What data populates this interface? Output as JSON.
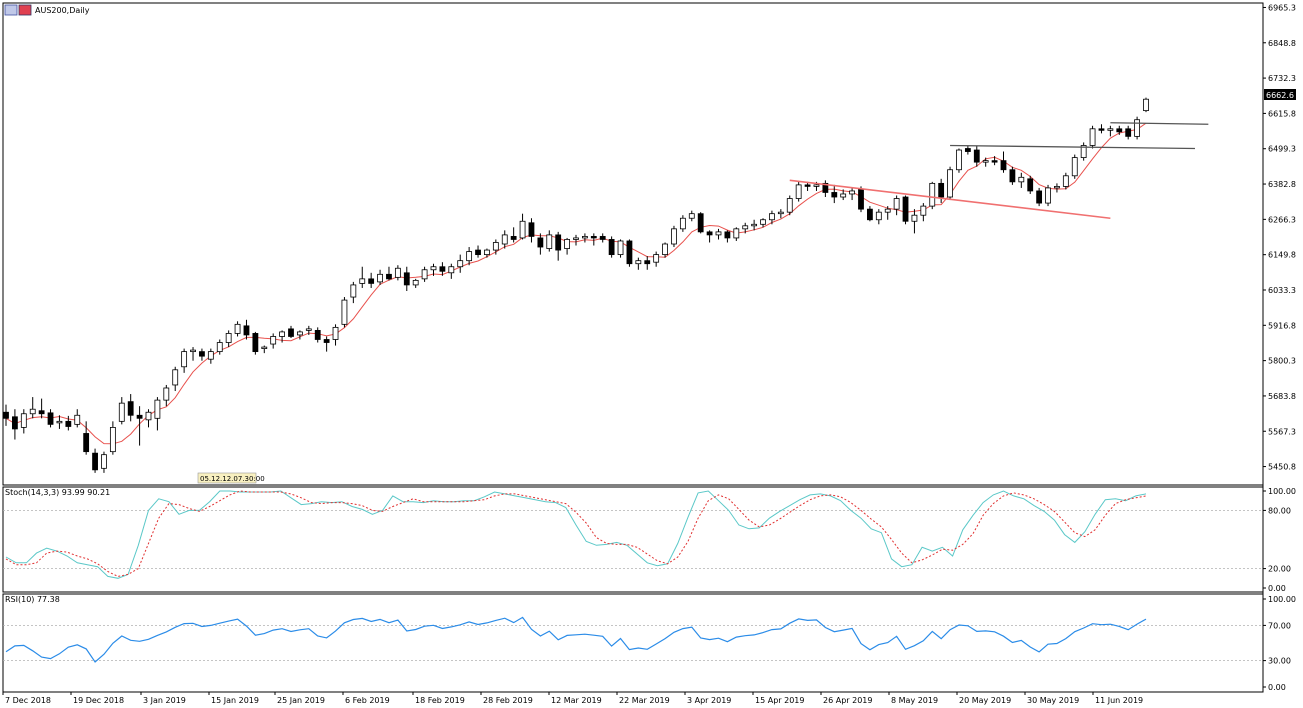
{
  "window": {
    "title": "AUS200,Daily"
  },
  "toolbar_badge": "05.12.12.07.30:00",
  "colors": {
    "bull_fill": "#ffffff",
    "bear_fill": "#000000",
    "ma": "#e8514d",
    "trend_red": "#f07070",
    "trend_gray": "#555555",
    "stoch_main": "#5bc8c8",
    "stoch_signal": "#e03030",
    "rsi": "#2b8ce8",
    "grid": "#b0b0b0"
  },
  "price_axis": {
    "ticks": [
      "6965.3",
      "6848.8",
      "6732.3",
      "6615.8",
      "6499.3",
      "6382.8",
      "6266.3",
      "6149.8",
      "6033.3",
      "5916.8",
      "5800.3",
      "5683.8",
      "5567.3",
      "5450.8"
    ],
    "current_price": "6662.6"
  },
  "date_axis": [
    "7 Dec 2018",
    "19 Dec 2018",
    "3 Jan 2019",
    "15 Jan 2019",
    "25 Jan 2019",
    "6 Feb 2019",
    "18 Feb 2019",
    "28 Feb 2019",
    "12 Mar 2019",
    "22 Mar 2019",
    "3 Apr 2019",
    "15 Apr 2019",
    "26 Apr 2019",
    "8 May 2019",
    "20 May 2019",
    "30 May 2019",
    "11 Jun 2019"
  ],
  "stoch": {
    "label": "Stoch(14,3,3) 93.99 90.21",
    "levels": [
      "100.00",
      "80.00",
      "20.00",
      "0.00"
    ]
  },
  "rsi": {
    "label": "RSI(10) 77.38",
    "levels": [
      "100.00",
      "70.00",
      "30.00",
      "0.00"
    ]
  },
  "chart_data": {
    "type": "candlestick",
    "title": "AUS200,Daily",
    "y_range": [
      5390,
      6980
    ],
    "candles": [
      {
        "o": 5630,
        "h": 5655,
        "l": 5585,
        "c": 5610
      },
      {
        "o": 5615,
        "h": 5640,
        "l": 5540,
        "c": 5575
      },
      {
        "o": 5580,
        "h": 5640,
        "l": 5560,
        "c": 5625
      },
      {
        "o": 5625,
        "h": 5680,
        "l": 5610,
        "c": 5640
      },
      {
        "o": 5635,
        "h": 5675,
        "l": 5610,
        "c": 5625
      },
      {
        "o": 5628,
        "h": 5640,
        "l": 5580,
        "c": 5590
      },
      {
        "o": 5595,
        "h": 5620,
        "l": 5575,
        "c": 5600
      },
      {
        "o": 5600,
        "h": 5618,
        "l": 5570,
        "c": 5583
      },
      {
        "o": 5590,
        "h": 5640,
        "l": 5580,
        "c": 5620
      },
      {
        "o": 5560,
        "h": 5600,
        "l": 5490,
        "c": 5500
      },
      {
        "o": 5495,
        "h": 5510,
        "l": 5430,
        "c": 5440
      },
      {
        "o": 5445,
        "h": 5500,
        "l": 5430,
        "c": 5490
      },
      {
        "o": 5500,
        "h": 5600,
        "l": 5490,
        "c": 5580
      },
      {
        "o": 5600,
        "h": 5680,
        "l": 5590,
        "c": 5660
      },
      {
        "o": 5665,
        "h": 5690,
        "l": 5600,
        "c": 5620
      },
      {
        "o": 5620,
        "h": 5650,
        "l": 5520,
        "c": 5610
      },
      {
        "o": 5605,
        "h": 5640,
        "l": 5580,
        "c": 5630
      },
      {
        "o": 5610,
        "h": 5680,
        "l": 5570,
        "c": 5670
      },
      {
        "o": 5670,
        "h": 5720,
        "l": 5650,
        "c": 5710
      },
      {
        "o": 5720,
        "h": 5780,
        "l": 5700,
        "c": 5770
      },
      {
        "o": 5780,
        "h": 5840,
        "l": 5760,
        "c": 5830
      },
      {
        "o": 5830,
        "h": 5845,
        "l": 5800,
        "c": 5835
      },
      {
        "o": 5830,
        "h": 5840,
        "l": 5800,
        "c": 5815
      },
      {
        "o": 5805,
        "h": 5840,
        "l": 5790,
        "c": 5830
      },
      {
        "o": 5830,
        "h": 5870,
        "l": 5820,
        "c": 5860
      },
      {
        "o": 5860,
        "h": 5900,
        "l": 5845,
        "c": 5890
      },
      {
        "o": 5890,
        "h": 5930,
        "l": 5880,
        "c": 5920
      },
      {
        "o": 5915,
        "h": 5935,
        "l": 5870,
        "c": 5885
      },
      {
        "o": 5890,
        "h": 5895,
        "l": 5820,
        "c": 5830
      },
      {
        "o": 5840,
        "h": 5850,
        "l": 5825,
        "c": 5845
      },
      {
        "o": 5855,
        "h": 5890,
        "l": 5840,
        "c": 5880
      },
      {
        "o": 5880,
        "h": 5900,
        "l": 5860,
        "c": 5895
      },
      {
        "o": 5905,
        "h": 5915,
        "l": 5875,
        "c": 5880
      },
      {
        "o": 5885,
        "h": 5900,
        "l": 5870,
        "c": 5895
      },
      {
        "o": 5900,
        "h": 5915,
        "l": 5885,
        "c": 5905
      },
      {
        "o": 5900,
        "h": 5910,
        "l": 5860,
        "c": 5870
      },
      {
        "o": 5870,
        "h": 5880,
        "l": 5830,
        "c": 5860
      },
      {
        "o": 5870,
        "h": 5920,
        "l": 5850,
        "c": 5910
      },
      {
        "o": 5920,
        "h": 6010,
        "l": 5910,
        "c": 6000
      },
      {
        "o": 6010,
        "h": 6060,
        "l": 5990,
        "c": 6050
      },
      {
        "o": 6055,
        "h": 6110,
        "l": 6040,
        "c": 6070
      },
      {
        "o": 6070,
        "h": 6090,
        "l": 6040,
        "c": 6055
      },
      {
        "o": 6060,
        "h": 6100,
        "l": 6050,
        "c": 6085
      },
      {
        "o": 6085,
        "h": 6110,
        "l": 6065,
        "c": 6070
      },
      {
        "o": 6075,
        "h": 6115,
        "l": 6065,
        "c": 6105
      },
      {
        "o": 6090,
        "h": 6110,
        "l": 6030,
        "c": 6050
      },
      {
        "o": 6050,
        "h": 6070,
        "l": 6040,
        "c": 6065
      },
      {
        "o": 6070,
        "h": 6110,
        "l": 6060,
        "c": 6100
      },
      {
        "o": 6100,
        "h": 6120,
        "l": 6080,
        "c": 6110
      },
      {
        "o": 6110,
        "h": 6125,
        "l": 6080,
        "c": 6095
      },
      {
        "o": 6090,
        "h": 6120,
        "l": 6070,
        "c": 6110
      },
      {
        "o": 6110,
        "h": 6150,
        "l": 6090,
        "c": 6130
      },
      {
        "o": 6130,
        "h": 6175,
        "l": 6115,
        "c": 6160
      },
      {
        "o": 6165,
        "h": 6180,
        "l": 6140,
        "c": 6150
      },
      {
        "o": 6150,
        "h": 6170,
        "l": 6140,
        "c": 6165
      },
      {
        "o": 6165,
        "h": 6200,
        "l": 6150,
        "c": 6190
      },
      {
        "o": 6185,
        "h": 6230,
        "l": 6170,
        "c": 6215
      },
      {
        "o": 6210,
        "h": 6240,
        "l": 6190,
        "c": 6200
      },
      {
        "o": 6205,
        "h": 6285,
        "l": 6200,
        "c": 6260
      },
      {
        "o": 6255,
        "h": 6270,
        "l": 6190,
        "c": 6210
      },
      {
        "o": 6205,
        "h": 6220,
        "l": 6150,
        "c": 6175
      },
      {
        "o": 6170,
        "h": 6230,
        "l": 6160,
        "c": 6215
      },
      {
        "o": 6215,
        "h": 6225,
        "l": 6130,
        "c": 6165
      },
      {
        "o": 6170,
        "h": 6205,
        "l": 6150,
        "c": 6200
      },
      {
        "o": 6200,
        "h": 6215,
        "l": 6180,
        "c": 6205
      },
      {
        "o": 6205,
        "h": 6220,
        "l": 6190,
        "c": 6210
      },
      {
        "o": 6210,
        "h": 6220,
        "l": 6180,
        "c": 6205
      },
      {
        "o": 6210,
        "h": 6220,
        "l": 6190,
        "c": 6200
      },
      {
        "o": 6200,
        "h": 6210,
        "l": 6140,
        "c": 6150
      },
      {
        "o": 6150,
        "h": 6200,
        "l": 6140,
        "c": 6195
      },
      {
        "o": 6195,
        "h": 6200,
        "l": 6110,
        "c": 6120
      },
      {
        "o": 6120,
        "h": 6140,
        "l": 6100,
        "c": 6130
      },
      {
        "o": 6130,
        "h": 6145,
        "l": 6100,
        "c": 6120
      },
      {
        "o": 6125,
        "h": 6160,
        "l": 6110,
        "c": 6150
      },
      {
        "o": 6150,
        "h": 6190,
        "l": 6140,
        "c": 6185
      },
      {
        "o": 6185,
        "h": 6245,
        "l": 6175,
        "c": 6235
      },
      {
        "o": 6235,
        "h": 6280,
        "l": 6225,
        "c": 6270
      },
      {
        "o": 6270,
        "h": 6295,
        "l": 6260,
        "c": 6285
      },
      {
        "o": 6285,
        "h": 6290,
        "l": 6220,
        "c": 6225
      },
      {
        "o": 6225,
        "h": 6230,
        "l": 6190,
        "c": 6215
      },
      {
        "o": 6215,
        "h": 6235,
        "l": 6200,
        "c": 6225
      },
      {
        "o": 6225,
        "h": 6230,
        "l": 6190,
        "c": 6205
      },
      {
        "o": 6205,
        "h": 6240,
        "l": 6195,
        "c": 6235
      },
      {
        "o": 6235,
        "h": 6255,
        "l": 6220,
        "c": 6245
      },
      {
        "o": 6245,
        "h": 6265,
        "l": 6230,
        "c": 6250
      },
      {
        "o": 6250,
        "h": 6270,
        "l": 6240,
        "c": 6265
      },
      {
        "o": 6265,
        "h": 6295,
        "l": 6250,
        "c": 6285
      },
      {
        "o": 6285,
        "h": 6300,
        "l": 6270,
        "c": 6290
      },
      {
        "o": 6290,
        "h": 6345,
        "l": 6280,
        "c": 6335
      },
      {
        "o": 6335,
        "h": 6390,
        "l": 6325,
        "c": 6380
      },
      {
        "o": 6380,
        "h": 6390,
        "l": 6360,
        "c": 6375
      },
      {
        "o": 6375,
        "h": 6390,
        "l": 6360,
        "c": 6380
      },
      {
        "o": 6385,
        "h": 6395,
        "l": 6340,
        "c": 6355
      },
      {
        "o": 6355,
        "h": 6380,
        "l": 6320,
        "c": 6340
      },
      {
        "o": 6340,
        "h": 6365,
        "l": 6330,
        "c": 6350
      },
      {
        "o": 6350,
        "h": 6370,
        "l": 6330,
        "c": 6360
      },
      {
        "o": 6365,
        "h": 6375,
        "l": 6290,
        "c": 6300
      },
      {
        "o": 6300,
        "h": 6310,
        "l": 6260,
        "c": 6265
      },
      {
        "o": 6265,
        "h": 6300,
        "l": 6250,
        "c": 6290
      },
      {
        "o": 6290,
        "h": 6310,
        "l": 6265,
        "c": 6300
      },
      {
        "o": 6300,
        "h": 6345,
        "l": 6280,
        "c": 6335
      },
      {
        "o": 6340,
        "h": 6345,
        "l": 6250,
        "c": 6260
      },
      {
        "o": 6260,
        "h": 6300,
        "l": 6220,
        "c": 6280
      },
      {
        "o": 6280,
        "h": 6320,
        "l": 6260,
        "c": 6310
      },
      {
        "o": 6310,
        "h": 6390,
        "l": 6300,
        "c": 6385
      },
      {
        "o": 6385,
        "h": 6400,
        "l": 6320,
        "c": 6340
      },
      {
        "o": 6340,
        "h": 6440,
        "l": 6330,
        "c": 6430
      },
      {
        "o": 6430,
        "h": 6500,
        "l": 6420,
        "c": 6495
      },
      {
        "o": 6500,
        "h": 6510,
        "l": 6480,
        "c": 6490
      },
      {
        "o": 6495,
        "h": 6510,
        "l": 6440,
        "c": 6455
      },
      {
        "o": 6455,
        "h": 6470,
        "l": 6440,
        "c": 6460
      },
      {
        "o": 6460,
        "h": 6475,
        "l": 6445,
        "c": 6455
      },
      {
        "o": 6460,
        "h": 6490,
        "l": 6420,
        "c": 6430
      },
      {
        "o": 6430,
        "h": 6440,
        "l": 6380,
        "c": 6390
      },
      {
        "o": 6390,
        "h": 6420,
        "l": 6370,
        "c": 6405
      },
      {
        "o": 6400,
        "h": 6410,
        "l": 6350,
        "c": 6360
      },
      {
        "o": 6360,
        "h": 6370,
        "l": 6310,
        "c": 6320
      },
      {
        "o": 6320,
        "h": 6380,
        "l": 6310,
        "c": 6370
      },
      {
        "o": 6370,
        "h": 6385,
        "l": 6355,
        "c": 6375
      },
      {
        "o": 6375,
        "h": 6420,
        "l": 6365,
        "c": 6410
      },
      {
        "o": 6410,
        "h": 6480,
        "l": 6400,
        "c": 6470
      },
      {
        "o": 6470,
        "h": 6520,
        "l": 6460,
        "c": 6510
      },
      {
        "o": 6510,
        "h": 6575,
        "l": 6500,
        "c": 6565
      },
      {
        "o": 6565,
        "h": 6580,
        "l": 6550,
        "c": 6560
      },
      {
        "o": 6560,
        "h": 6575,
        "l": 6540,
        "c": 6565
      },
      {
        "o": 6565,
        "h": 6575,
        "l": 6545,
        "c": 6555
      },
      {
        "o": 6565,
        "h": 6575,
        "l": 6530,
        "c": 6540
      },
      {
        "o": 6540,
        "h": 6605,
        "l": 6530,
        "c": 6595
      },
      {
        "o": 6625,
        "h": 6668,
        "l": 6620,
        "c": 6662.6
      }
    ],
    "ma_period": 5,
    "stoch_main": [
      32,
      26,
      26,
      36,
      41,
      38,
      33,
      26,
      24,
      22,
      12,
      10,
      14,
      44,
      80,
      92,
      89,
      76,
      80,
      80,
      89,
      100,
      100,
      99,
      99,
      99,
      99,
      100,
      93,
      86,
      87,
      89,
      88,
      89,
      84,
      81,
      76,
      80,
      95,
      89,
      89,
      88,
      90,
      89,
      89,
      90,
      90,
      94,
      99,
      97,
      95,
      93,
      91,
      89,
      88,
      83,
      65,
      48,
      44,
      45,
      47,
      44,
      35,
      26,
      23,
      25,
      46,
      73,
      98,
      100,
      90,
      80,
      65,
      61,
      62,
      72,
      79,
      85,
      91,
      96,
      97,
      95,
      90,
      80,
      72,
      61,
      57,
      30,
      22,
      24,
      42,
      38,
      42,
      33,
      60,
      75,
      88,
      96,
      100,
      95,
      92,
      85,
      79,
      70,
      55,
      47,
      58,
      76,
      91,
      92,
      90,
      95,
      97
    ],
    "stoch_signal": [
      30,
      24,
      24,
      26,
      36,
      38,
      37,
      33,
      30,
      25,
      17,
      12,
      14,
      20,
      46,
      72,
      87,
      86,
      82,
      79,
      84,
      90,
      96,
      100,
      99,
      99,
      99,
      99,
      97,
      93,
      88,
      87,
      88,
      88,
      87,
      85,
      80,
      79,
      84,
      88,
      92,
      89,
      89,
      89,
      89,
      89,
      90,
      91,
      95,
      97,
      97,
      95,
      93,
      91,
      89,
      87,
      78,
      67,
      52,
      46,
      45,
      45,
      42,
      35,
      28,
      25,
      32,
      48,
      72,
      90,
      96,
      92,
      81,
      70,
      63,
      65,
      71,
      78,
      85,
      91,
      95,
      96,
      94,
      88,
      80,
      71,
      63,
      50,
      36,
      26,
      29,
      34,
      40,
      39,
      45,
      56,
      75,
      87,
      95,
      98,
      96,
      92,
      86,
      79,
      68,
      57,
      53,
      60,
      75,
      87,
      91,
      93,
      95
    ]
  }
}
